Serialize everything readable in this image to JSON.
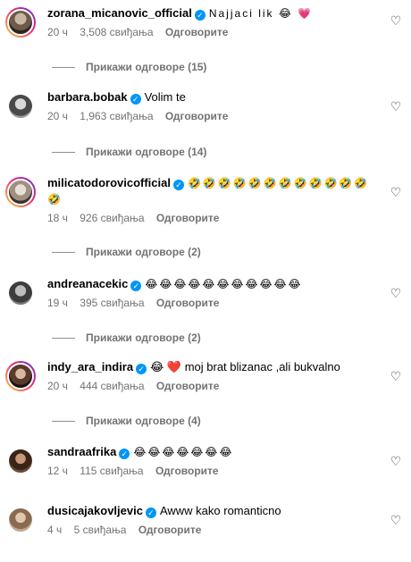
{
  "icons": {
    "like": "heart-outline-icon",
    "verified": "verified-badge-icon"
  },
  "colors": {
    "verified": "#0095f6",
    "meta_text": "#737373",
    "story_ring": "#ee2a7b"
  },
  "comments": [
    {
      "username": "zorana_micanovic_official",
      "text": "Najjaci lik 😂 💗",
      "time": "20 ч",
      "likes": "3,508 свиђања",
      "reply": "Одговорите",
      "view_replies": "Прикажи одговоре (15)"
    },
    {
      "username": "barbara.bobak",
      "text": "Volim te",
      "time": "20 ч",
      "likes": "1,963 свиђања",
      "reply": "Одговорите",
      "view_replies": "Прикажи одговоре (14)"
    },
    {
      "username": "milicatodorovicofficial",
      "text": "🤣🤣🤣🤣🤣🤣🤣🤣🤣🤣🤣🤣🤣",
      "time": "18 ч",
      "likes": "926 свиђања",
      "reply": "Одговорите",
      "view_replies": "Прикажи одговоре (2)"
    },
    {
      "username": "andreanacekic",
      "text": "😂😂😂😂😂😂😂😂😂😂😂",
      "time": "19 ч",
      "likes": "395 свиђања",
      "reply": "Одговорите",
      "view_replies": "Прикажи одговоре (2)"
    },
    {
      "username": "indy_ara_indira",
      "text": "😂 ❤️ moj brat blizanac ,ali bukvalno",
      "time": "20 ч",
      "likes": "444 свиђања",
      "reply": "Одговорите",
      "view_replies": "Прикажи одговоре (4)"
    },
    {
      "username": "sandraafrika",
      "text": "😂😂😂😂😂😂😂",
      "time": "12 ч",
      "likes": "115 свиђања",
      "reply": "Одговорите"
    },
    {
      "username": "dusicajakovljevic",
      "text": "Awww kako romanticno",
      "time": "4 ч",
      "likes": "5 свиђања",
      "reply": "Одговорите"
    }
  ]
}
